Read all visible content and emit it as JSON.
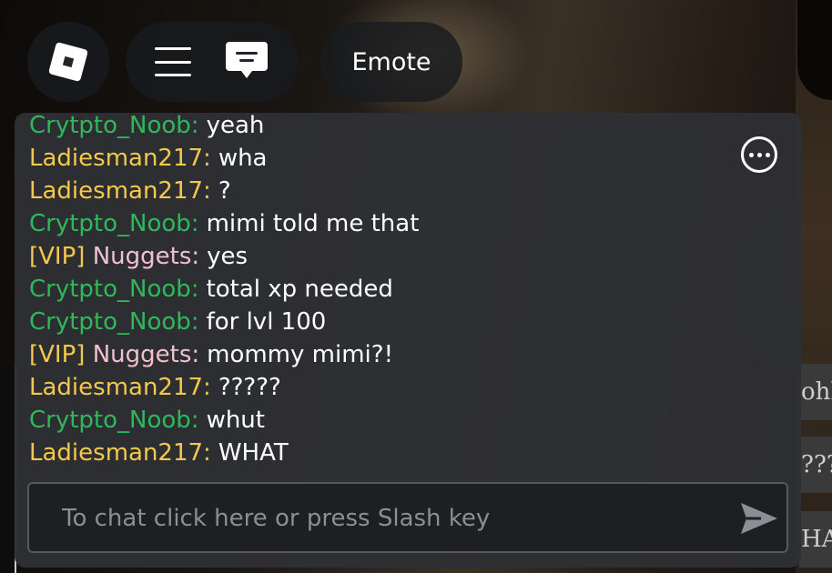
{
  "topbar": {
    "emote_label": "Emote"
  },
  "chat": {
    "messages": [
      {
        "tag": "",
        "name": "Crytpto_Noob:",
        "color": "green",
        "text": "yeah"
      },
      {
        "tag": "",
        "name": "Ladiesman217:",
        "color": "yellow",
        "text": "wha"
      },
      {
        "tag": "",
        "name": "Ladiesman217:",
        "color": "yellow",
        "text": "?"
      },
      {
        "tag": "",
        "name": "Crytpto_Noob:",
        "color": "green",
        "text": "mimi told me that"
      },
      {
        "tag": "[VIP]",
        "name": "Nuggets:",
        "color": "pink",
        "text": "yes"
      },
      {
        "tag": "",
        "name": "Crytpto_Noob:",
        "color": "green",
        "text": "total xp needed"
      },
      {
        "tag": "",
        "name": "Crytpto_Noob:",
        "color": "green",
        "text": "for lvl 100"
      },
      {
        "tag": "[VIP]",
        "name": "Nuggets:",
        "color": "pink",
        "text": "mommy mimi?!"
      },
      {
        "tag": "",
        "name": "Ladiesman217:",
        "color": "yellow",
        "text": "?????"
      },
      {
        "tag": "",
        "name": "Crytpto_Noob:",
        "color": "green",
        "text": "whut"
      },
      {
        "tag": "",
        "name": "Ladiesman217:",
        "color": "yellow",
        "text": "WHAT"
      }
    ],
    "input": {
      "value": "",
      "placeholder": "To chat click here or press Slash key"
    }
  },
  "background_signs": [
    "ohh",
    "???",
    "HA"
  ],
  "icons": {
    "roblox": "roblox-logo-icon",
    "menu": "hamburger-menu-icon",
    "chat": "chat-bubble-icon",
    "more": "more-options-icon",
    "send": "send-arrow-icon"
  },
  "colors": {
    "name_green": "#2fb85a",
    "name_yellow": "#f2c94c",
    "name_pink": "#f0c0cc",
    "panel": "#2e3034"
  }
}
